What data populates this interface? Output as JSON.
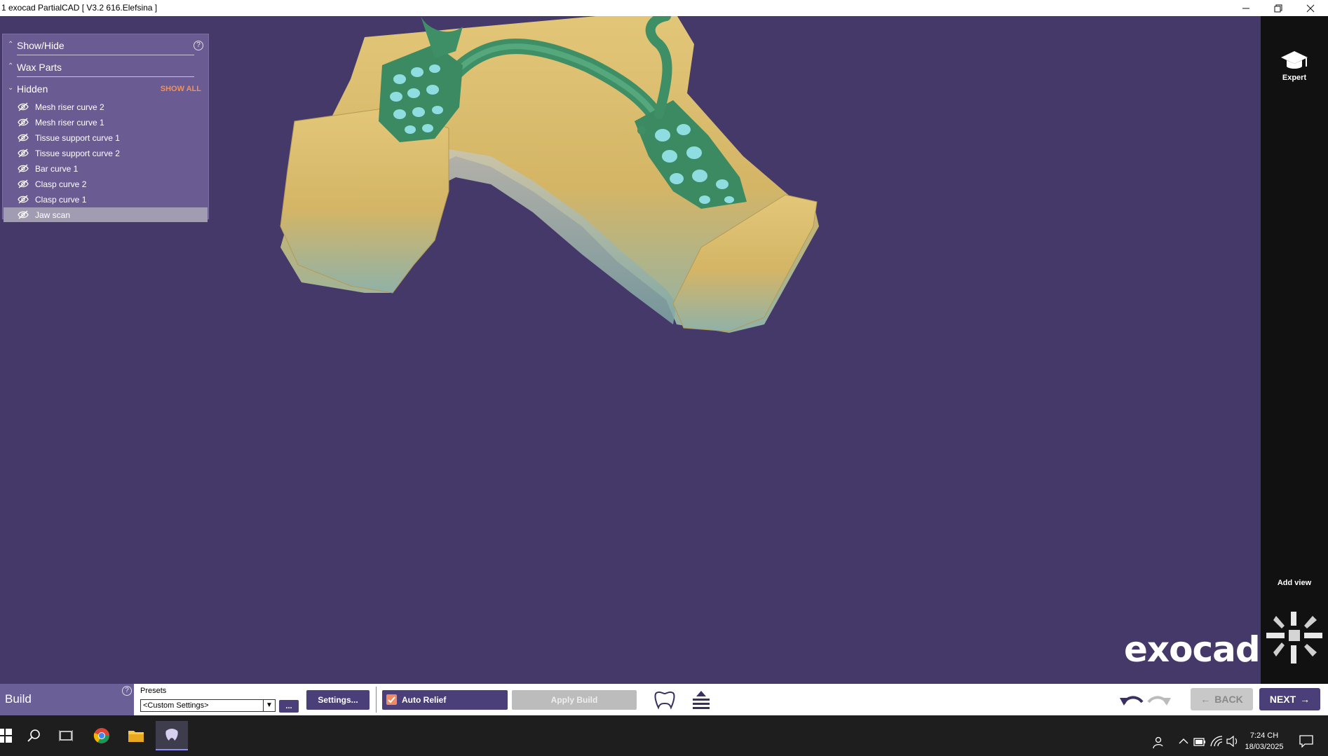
{
  "window": {
    "title": "1 exocad PartialCAD [ V3.2 616.Elefsina ]",
    "minimize_icon": "minimize-icon",
    "restore_icon": "restore-icon",
    "close_icon": "close-icon"
  },
  "panel": {
    "show_hide_label": "Show/Hide",
    "wax_parts_label": "Wax Parts",
    "hidden_label": "Hidden",
    "show_all_label": "SHOW ALL",
    "help_glyph": "?",
    "items": [
      {
        "label": "Mesh riser curve 2",
        "selected": false
      },
      {
        "label": "Mesh riser curve 1",
        "selected": false
      },
      {
        "label": "Tissue support curve 1",
        "selected": false
      },
      {
        "label": "Tissue support curve 2",
        "selected": false
      },
      {
        "label": "Bar curve 1",
        "selected": false
      },
      {
        "label": "Clasp curve 2",
        "selected": false
      },
      {
        "label": "Clasp curve 1",
        "selected": false
      },
      {
        "label": "Jaw scan",
        "selected": true
      }
    ]
  },
  "rightbar": {
    "expert_label": "Expert",
    "add_view_label": "Add view"
  },
  "brand": "exocad",
  "toolbar": {
    "step_label": "Build",
    "presets_label": "Presets",
    "preset_value": "<Custom Settings>",
    "more_label": "...",
    "settings_label": "Settings...",
    "auto_relief_label": "Auto Relief",
    "auto_relief_checked": true,
    "apply_build_label": "Apply Build",
    "back_label": "BACK",
    "next_label": "NEXT"
  },
  "taskbar": {
    "time": "7:24 CH",
    "date": "18/03/2025"
  },
  "colors": {
    "viewport_bg": "#453969",
    "accent_orange": "#f0905a",
    "button_purple": "#4a3f78",
    "panel_bg": "#6e6096"
  }
}
